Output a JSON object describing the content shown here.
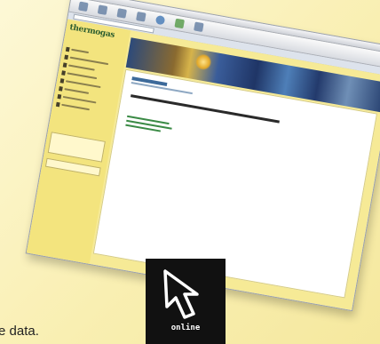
{
  "caption_text": "e data.",
  "badge": {
    "label": "online",
    "icon": "cursor-arrow-icon"
  },
  "website": {
    "logo_text": "thermogas",
    "toolbar_icons": [
      "back-icon",
      "forward-icon",
      "reload-icon",
      "home-icon",
      "globe-icon",
      "print-icon",
      "mail-icon"
    ]
  },
  "colors": {
    "background": "#fbf3bf",
    "badge": "#111111",
    "page_yellow": "#f6ea96"
  }
}
